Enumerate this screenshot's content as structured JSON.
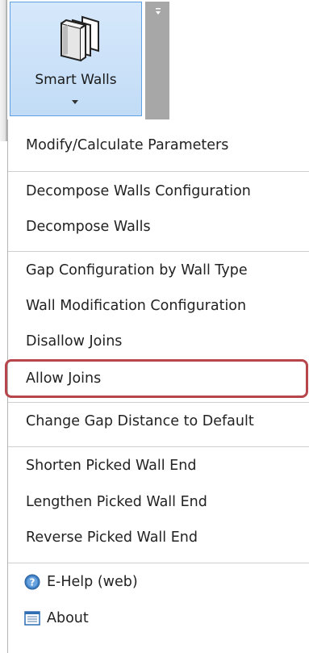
{
  "ribbon": {
    "button_label": "Smart Walls",
    "button_icon": "walls-icon",
    "launcher_icon": "panel-launcher-icon"
  },
  "menu": {
    "items": [
      {
        "label": "Modify/Calculate Parameters"
      },
      {
        "label": "Decompose Walls Configuration"
      },
      {
        "label": "Decompose Walls"
      },
      {
        "label": "Gap Configuration by Wall Type"
      },
      {
        "label": "Wall Modification Configuration"
      },
      {
        "label": "Disallow Joins"
      },
      {
        "label": "Allow Joins",
        "highlighted": true
      },
      {
        "label": "Change Gap Distance to Default"
      },
      {
        "label": "Shorten Picked Wall End"
      },
      {
        "label": "Lengthen Picked Wall End"
      },
      {
        "label": "Reverse Picked Wall End"
      },
      {
        "label": "E-Help (web)",
        "icon": "help-icon"
      },
      {
        "label": "About",
        "icon": "about-icon"
      }
    ]
  },
  "colors": {
    "button_bg": "#c8dff7",
    "button_border": "#5fa0e2",
    "highlight_ring": "#b7464c",
    "separator": "#cfcfcf"
  }
}
